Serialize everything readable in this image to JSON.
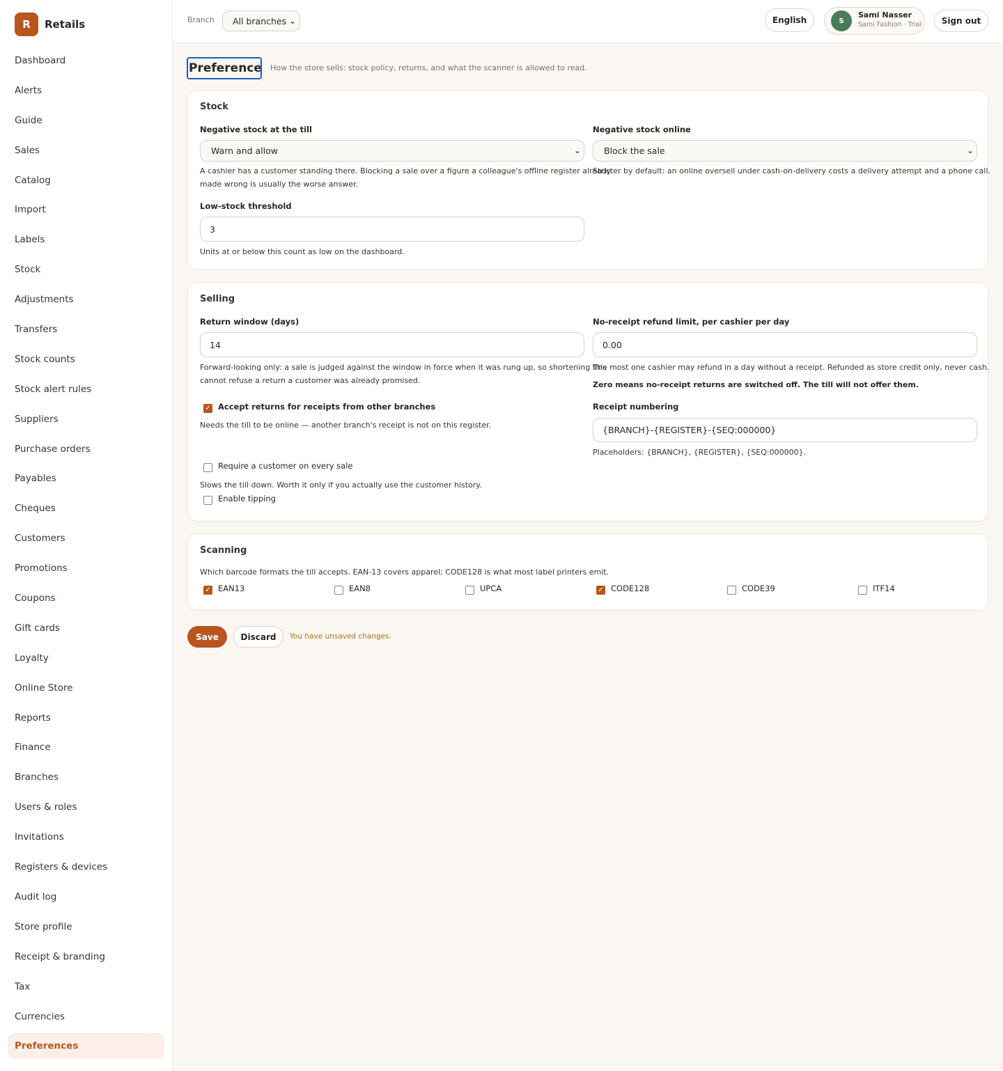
{
  "brand": {
    "logo_letter": "R",
    "name": "Retails"
  },
  "sidebar": {
    "items": [
      {
        "label": "Dashboard"
      },
      {
        "label": "Alerts"
      },
      {
        "label": "Guide"
      },
      {
        "label": "Sales"
      },
      {
        "label": "Catalog"
      },
      {
        "label": "Import"
      },
      {
        "label": "Labels"
      },
      {
        "label": "Stock"
      },
      {
        "label": "Adjustments"
      },
      {
        "label": "Transfers"
      },
      {
        "label": "Stock counts"
      },
      {
        "label": "Stock alert rules"
      },
      {
        "label": "Suppliers"
      },
      {
        "label": "Purchase orders"
      },
      {
        "label": "Payables"
      },
      {
        "label": "Cheques"
      },
      {
        "label": "Customers"
      },
      {
        "label": "Promotions"
      },
      {
        "label": "Coupons"
      },
      {
        "label": "Gift cards"
      },
      {
        "label": "Loyalty"
      },
      {
        "label": "Online Store"
      },
      {
        "label": "Reports"
      },
      {
        "label": "Finance"
      },
      {
        "label": "Branches"
      },
      {
        "label": "Users & roles"
      },
      {
        "label": "Invitations"
      },
      {
        "label": "Registers & devices"
      },
      {
        "label": "Audit log"
      },
      {
        "label": "Store profile"
      },
      {
        "label": "Receipt & branding"
      },
      {
        "label": "Tax"
      },
      {
        "label": "Currencies"
      },
      {
        "label": "Preferences"
      }
    ],
    "active": "Preferences"
  },
  "topbar": {
    "branch_label": "Branch",
    "branch_value": "All branches",
    "language": "English",
    "user": {
      "initial": "S",
      "name": "Sami Nasser",
      "subtitle": "Sami Fashion · Trial"
    },
    "sign_out": "Sign out"
  },
  "page": {
    "title": "Preferences",
    "subtitle": "How the store sells: stock policy, returns, and what the scanner is allowed to read."
  },
  "stock": {
    "title": "Stock",
    "neg_till_label": "Negative stock at the till",
    "neg_till_value": "Warn and allow",
    "neg_till_help_1": "A cashier has a customer standing there. Blocking a sale over a figure a colleague's offline register already",
    "neg_till_help_2": "made wrong is usually the worse answer.",
    "neg_online_label": "Negative stock online",
    "neg_online_value": "Block the sale",
    "neg_online_help": "Stricter by default: an online oversell under cash-on-delivery costs a delivery attempt and a phone call.",
    "low_label": "Low-stock threshold",
    "low_value": "3",
    "low_help": "Units at or below this count as low on the dashboard."
  },
  "selling": {
    "title": "Selling",
    "return_label": "Return window (days)",
    "return_value": "14",
    "return_help_1": "Forward-looking only: a sale is judged against the window in force when it was rung up, so shortening this",
    "return_help_2": "cannot refuse a return a customer was already promised.",
    "refund_label": "No-receipt refund limit, per cashier per day",
    "refund_value": "0.00",
    "refund_help": "The most one cashier may refund in a day without a receipt. Refunded as store credit only, never cash.",
    "refund_warning": "Zero means no-receipt returns are switched off. The till will not offer them.",
    "other_branch_label": "Accept returns for receipts from other branches",
    "other_branch_checked": true,
    "other_branch_help": "Needs the till to be online — another branch's receipt is not on this register.",
    "numbering_label": "Receipt numbering",
    "numbering_value": "{BRANCH}-{REGISTER}-{SEQ:000000}",
    "numbering_help": "Placeholders: {BRANCH}, {REGISTER}, {SEQ:000000}.",
    "require_customer_label": "Require a customer on every sale",
    "require_customer_checked": false,
    "require_customer_help": "Slows the till down. Worth it only if you actually use the customer history.",
    "tipping_label": "Enable tipping",
    "tipping_checked": false
  },
  "scanning": {
    "title": "Scanning",
    "help": "Which barcode formats the till accepts. EAN-13 covers apparel; CODE128 is what most label printers emit.",
    "formats": [
      {
        "label": "EAN13",
        "checked": true
      },
      {
        "label": "EAN8",
        "checked": false
      },
      {
        "label": "UPCA",
        "checked": false
      },
      {
        "label": "CODE128",
        "checked": true
      },
      {
        "label": "CODE39",
        "checked": false
      },
      {
        "label": "ITF14",
        "checked": false
      }
    ]
  },
  "actions": {
    "save": "Save",
    "discard": "Discard",
    "status": "You have unsaved changes."
  },
  "colors": {
    "accent": "#b8561f",
    "active_nav_bg": "#fcefe8",
    "focus_ring": "#1d5ec0",
    "warning_text": "#a8741e"
  }
}
